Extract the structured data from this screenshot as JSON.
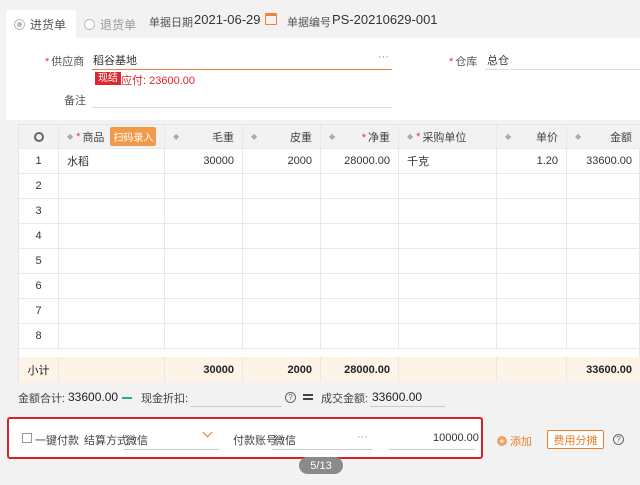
{
  "tabs": [
    {
      "label": "进货单",
      "active": true
    },
    {
      "label": "退货单",
      "active": false
    }
  ],
  "header": {
    "date_label": "单据日期",
    "date_value": "2021-06-29",
    "number_label": "单据编号",
    "number_value": "PS-20210629-001"
  },
  "form": {
    "supplier_label": "供应商",
    "supplier_value": "稻谷基地",
    "cash_badge": "现结",
    "payable_text": "应付: 23600.00",
    "warehouse_label": "仓库",
    "warehouse_value": "总仓",
    "remark_label": "备注",
    "more": "···"
  },
  "grid": {
    "scan_button": "扫码录入",
    "columns": [
      "商品",
      "毛重",
      "皮重",
      "净重",
      "采购单位",
      "单价",
      "金额"
    ],
    "rows": [
      {
        "n": "1",
        "product": "水稻",
        "gross": "30000",
        "tare": "2000",
        "net": "28000.00",
        "unit": "千克",
        "price": "1.20",
        "amount": "33600.00"
      },
      {
        "n": "2",
        "product": "",
        "gross": "",
        "tare": "",
        "net": "",
        "unit": "",
        "price": "",
        "amount": ""
      },
      {
        "n": "3",
        "product": "",
        "gross": "",
        "tare": "",
        "net": "",
        "unit": "",
        "price": "",
        "amount": ""
      },
      {
        "n": "4",
        "product": "",
        "gross": "",
        "tare": "",
        "net": "",
        "unit": "",
        "price": "",
        "amount": ""
      },
      {
        "n": "5",
        "product": "",
        "gross": "",
        "tare": "",
        "net": "",
        "unit": "",
        "price": "",
        "amount": ""
      },
      {
        "n": "6",
        "product": "",
        "gross": "",
        "tare": "",
        "net": "",
        "unit": "",
        "price": "",
        "amount": ""
      },
      {
        "n": "7",
        "product": "",
        "gross": "",
        "tare": "",
        "net": "",
        "unit": "",
        "price": "",
        "amount": ""
      },
      {
        "n": "8",
        "product": "",
        "gross": "",
        "tare": "",
        "net": "",
        "unit": "",
        "price": "",
        "amount": ""
      }
    ],
    "subtotal": {
      "label": "小计",
      "gross": "30000",
      "tare": "2000",
      "net": "28000.00",
      "amount": "33600.00"
    }
  },
  "totals": {
    "total_label": "金额合计:",
    "total_value": "33600.00",
    "discount_label": "现金折扣:",
    "deal_label": "成交金额:",
    "deal_value": "33600.00",
    "help": "?"
  },
  "payment": {
    "one_click_label": "一键付款",
    "method_label": "结算方式",
    "method_value": "微信",
    "account_label": "付款账号",
    "account_value": "微信",
    "amount_value": "10000.00",
    "more": "···"
  },
  "actions": {
    "add_label": "添加",
    "fee_label": "费用分摊",
    "help": "?"
  },
  "pager": "5/13",
  "colors": {
    "accent": "#e87e2a",
    "highlight": "#d8202a",
    "subtotal_bg": "#fdf3e6"
  }
}
